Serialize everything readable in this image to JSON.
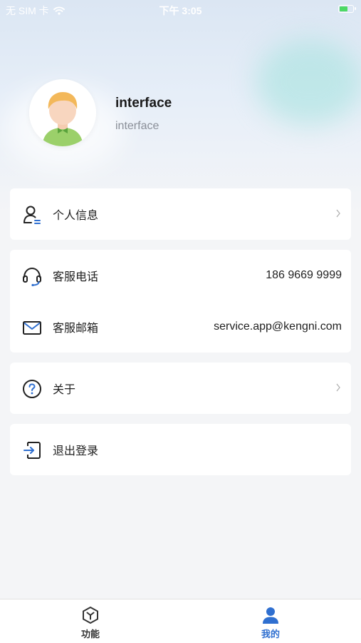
{
  "status_bar": {
    "carrier": "无 SIM 卡",
    "time": "下午 3:05",
    "icons": [
      "wifi-icon",
      "battery-charging-icon"
    ]
  },
  "profile": {
    "name": "interface",
    "subtitle": "interface"
  },
  "menu": {
    "personal_info": "个人信息",
    "service_phone_label": "客服电话",
    "service_phone_value": "186 9669 9999",
    "service_email_label": "客服邮箱",
    "service_email_value": "service.app@kengni.com",
    "about": "关于",
    "logout": "退出登录"
  },
  "tabbar": {
    "function_label": "功能",
    "mine_label": "我的",
    "active": "mine"
  },
  "colors": {
    "accent": "#2f6fd0",
    "background": "#f4f5f7",
    "card": "#ffffff",
    "text": "#1f1f1f",
    "muted": "#8a8f98"
  }
}
